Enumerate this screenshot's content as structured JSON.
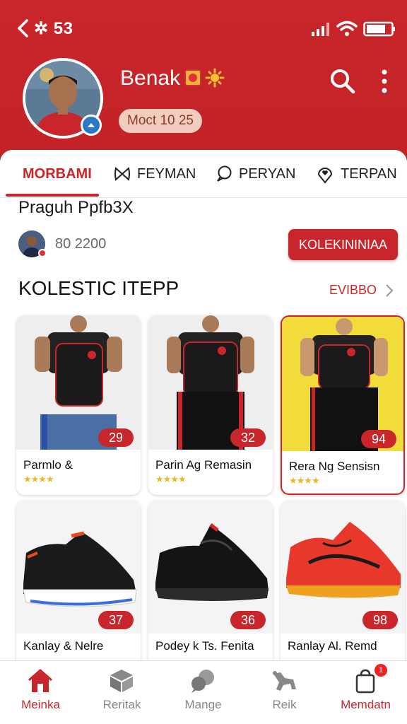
{
  "colors": {
    "brand_red": "#c8262b",
    "star_gold": "#e8b828",
    "badge_bg": "#f2cdbf"
  },
  "status_bar": {
    "time": "53"
  },
  "profile": {
    "name": "Benak",
    "badge": "Moct 10 25"
  },
  "tabs": [
    {
      "label": "MORBAMI",
      "icon": "none",
      "active": true
    },
    {
      "label": "FEYMAN",
      "icon": "bow-icon",
      "active": false
    },
    {
      "label": "PERYAN",
      "icon": "speech-bubble-icon",
      "active": false
    },
    {
      "label": "TERPAN",
      "icon": "heart-location-icon",
      "active": false
    }
  ],
  "section": {
    "title": "Praguh Ppfb3X",
    "author_stat": "80 2200",
    "collect_button": "KOLEKININIAA"
  },
  "collection": {
    "title": "KOLESTIC ITEPP",
    "see_all": "EVIBBO"
  },
  "products": [
    {
      "name": "Parmlo &",
      "price": "29",
      "stars": "★★★★"
    },
    {
      "name": "Parin Ag Remasin",
      "price": "32",
      "stars": "★★★★"
    },
    {
      "name": "Rera Ng Sensisn",
      "price": "94",
      "stars": "★★★★"
    },
    {
      "name": "Kanlay & Nelre",
      "price": "37"
    },
    {
      "name": "Podey k Ts. Fenita",
      "price": "36"
    },
    {
      "name": "Ranlay Al. Remd",
      "price": "98"
    }
  ],
  "bottom_nav": [
    {
      "label": "Meinka",
      "icon": "home-icon"
    },
    {
      "label": "Reritak",
      "icon": "box-icon"
    },
    {
      "label": "Mange",
      "icon": "chat-bubbles-icon"
    },
    {
      "label": "Reik",
      "icon": "animal-icon"
    },
    {
      "label": "Memdatn",
      "icon": "bag-icon",
      "badge": "1"
    }
  ]
}
